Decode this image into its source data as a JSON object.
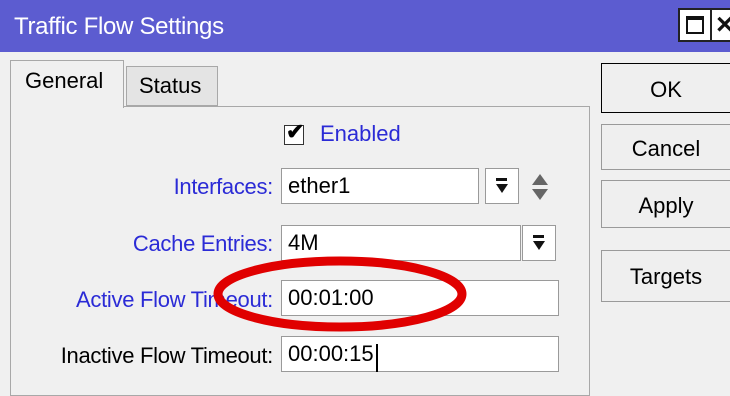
{
  "window": {
    "title": "Traffic Flow Settings"
  },
  "tabs": [
    {
      "label": "General",
      "active": true
    },
    {
      "label": "Status",
      "active": false
    }
  ],
  "form": {
    "enabled": {
      "label": "Enabled",
      "checked": true
    },
    "interfaces": {
      "label": "Interfaces:",
      "value": "ether1"
    },
    "cache_entries": {
      "label": "Cache Entries:",
      "value": "4M"
    },
    "active_flow_timeout": {
      "label": "Active Flow Timeout:",
      "value": "00:01:00"
    },
    "inactive_flow_timeout": {
      "label": "Inactive Flow Timeout:",
      "value": "00:00:15"
    }
  },
  "buttons": {
    "ok": "OK",
    "cancel": "Cancel",
    "apply": "Apply",
    "targets": "Targets"
  },
  "colors": {
    "titlebar": "#5c5cd0",
    "label_blue": "#2b2bd6",
    "annotation_red": "#e00000"
  },
  "icons": {
    "maximize": "maximize-icon",
    "close": "close-icon",
    "dropdown": "dropdown-arrow-icon",
    "updown": "up-down-arrows-icon",
    "check": "checkmark-icon"
  }
}
